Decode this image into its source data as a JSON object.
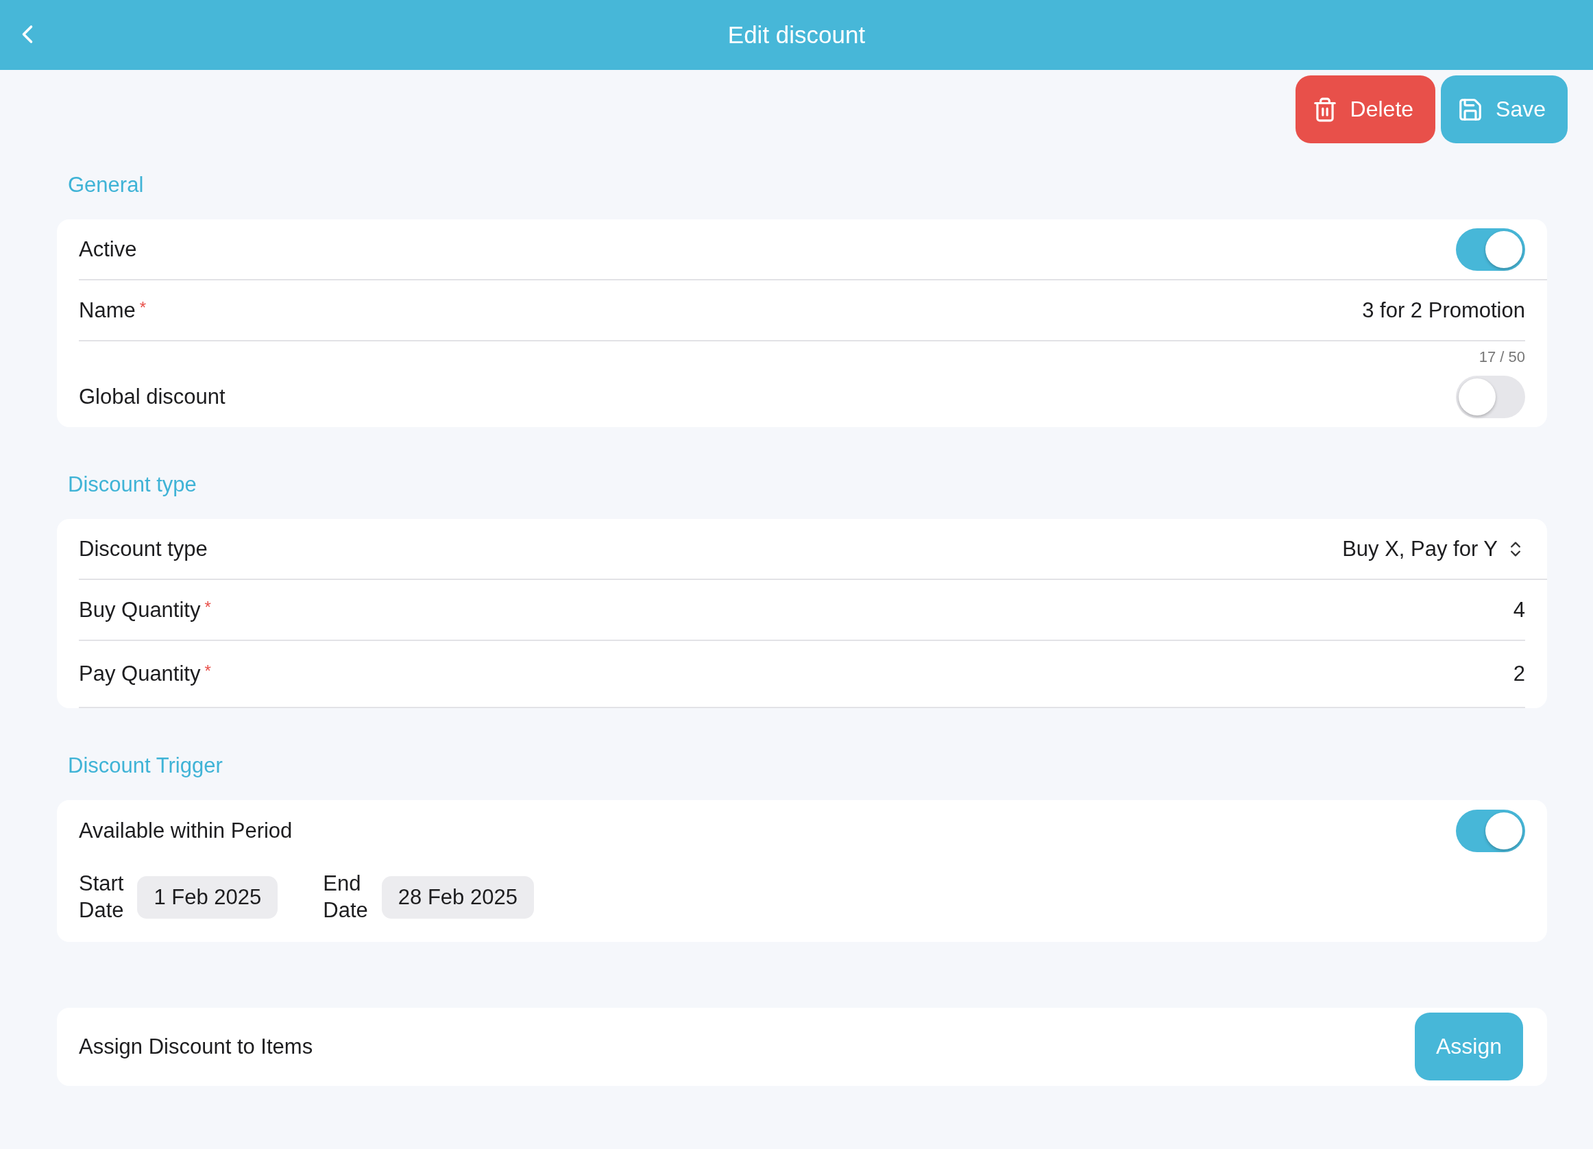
{
  "header": {
    "title": "Edit discount"
  },
  "actions": [
    {
      "kind": "delete",
      "label": "Delete"
    },
    {
      "kind": "save",
      "label": "Save"
    }
  ],
  "sections": [
    {
      "title": "General",
      "rows": [
        {
          "kind": "toggle",
          "label": "Active",
          "on": true
        },
        {
          "kind": "text",
          "label": "Name",
          "required": "*",
          "value": "3 for 2 Promotion",
          "counter": "17 / 50"
        },
        {
          "kind": "toggle",
          "label": "Global discount",
          "on": false
        }
      ]
    },
    {
      "title": "Discount type",
      "rows": [
        {
          "kind": "select",
          "label": "Discount type",
          "value": "Buy X, Pay for Y"
        },
        {
          "kind": "text",
          "label": "Buy Quantity",
          "required": "*",
          "value": "4"
        },
        {
          "kind": "text",
          "label": "Pay Quantity",
          "required": "*",
          "value": "2"
        }
      ]
    },
    {
      "title": "Discount Trigger",
      "rows": [
        {
          "kind": "toggle",
          "label": "Available within Period",
          "on": true
        },
        {
          "kind": "dates",
          "fields": [
            {
              "label": "Start Date",
              "value": "1 Feb 2025"
            },
            {
              "label": "End Date",
              "value": "28 Feb 2025"
            }
          ]
        }
      ]
    },
    {
      "rows": [
        {
          "kind": "button",
          "label": "Assign Discount to Items",
          "button": "Assign"
        }
      ]
    }
  ]
}
